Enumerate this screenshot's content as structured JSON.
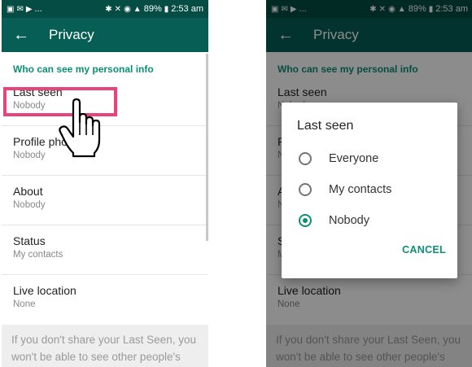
{
  "status_bar": {
    "left_icons": [
      "gallery-icon",
      "mail-icon",
      "play-icon"
    ],
    "dots": "...",
    "battery": "89%",
    "time": "2:53 am"
  },
  "app_bar": {
    "title": "Privacy"
  },
  "section_header": "Who can see my personal info",
  "items": [
    {
      "title": "Last seen",
      "value": "Nobody"
    },
    {
      "title": "Profile photo",
      "value": "Nobody"
    },
    {
      "title": "About",
      "value": "Nobody"
    },
    {
      "title": "Status",
      "value": "My contacts"
    },
    {
      "title": "Live location",
      "value": "None"
    }
  ],
  "info_text": "If you don't share your Last Seen, you won't be able to see other people's",
  "dialog": {
    "title": "Last seen",
    "options": [
      {
        "label": "Everyone",
        "selected": false
      },
      {
        "label": "My contacts",
        "selected": false
      },
      {
        "label": "Nobody",
        "selected": true
      }
    ],
    "cancel": "CANCEL"
  },
  "colors": {
    "status_bar": "#054d44",
    "app_bar": "#075e54",
    "accent": "#0b8f76",
    "highlight": "#e6447a"
  }
}
